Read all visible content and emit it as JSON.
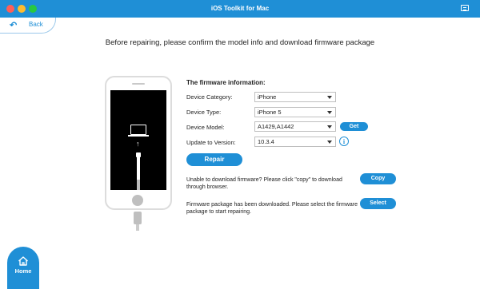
{
  "window": {
    "title": "iOS Toolkit for Mac",
    "traffic_colors": [
      "#ff5f57",
      "#febc2e",
      "#28c840"
    ]
  },
  "nav": {
    "back_label": "Back",
    "home_label": "Home"
  },
  "heading": "Before repairing, please confirm the model info and download firmware package",
  "firmware": {
    "section_title": "The firmware information:",
    "fields": [
      {
        "label": "Device Category:",
        "value": "iPhone"
      },
      {
        "label": "Device Type:",
        "value": "iPhone 5"
      },
      {
        "label": "Device Model:",
        "value": "A1429,A1442"
      },
      {
        "label": "Update to Version:",
        "value": "10.3.4"
      }
    ],
    "get_label": "Get",
    "repair_label": "Repair"
  },
  "download": {
    "copy_note": "Unable to download firmware? Please click \"copy\" to download through browser.",
    "copy_label": "Copy",
    "select_note": "Firmware package has been downloaded. Please select the firmware package to start repairing.",
    "select_label": "Select"
  },
  "colors": {
    "accent": "#1f8fd6"
  },
  "icons": [
    "back-arrow-icon",
    "menu-icon",
    "laptop-icon",
    "up-arrow-icon",
    "lightning-cable-icon",
    "info-icon",
    "home-icon"
  ]
}
